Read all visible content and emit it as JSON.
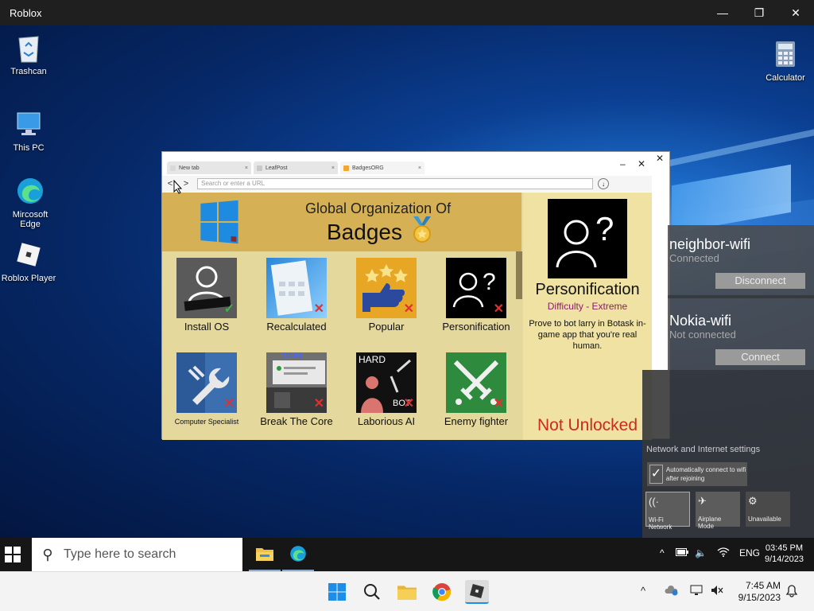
{
  "window": {
    "title": "Roblox",
    "minimize": "—",
    "maximize": "❐",
    "close": "✕"
  },
  "desktop_icons": [
    {
      "label": "Trashcan",
      "icon": "recycle-bin-icon"
    },
    {
      "label": "This PC",
      "icon": "computer-icon"
    },
    {
      "label": "Mircosoft Edge",
      "icon": "edge-icon"
    },
    {
      "label": "Roblox Player",
      "icon": "roblox-icon"
    },
    {
      "label": "Calculator",
      "icon": "calculator-icon"
    }
  ],
  "browser": {
    "tabs": [
      {
        "label": "New tab",
        "close": "×",
        "color": "#d9d9d9"
      },
      {
        "label": "LeafPost",
        "close": "×",
        "color": "#c9c9c9"
      },
      {
        "label": "BadgesORG",
        "close": "×",
        "color": "#f0a830"
      }
    ],
    "minimize": "–",
    "close": "✕",
    "back": "<",
    "forward": ">",
    "url_placeholder": "Search or enter a URL",
    "download": "↓",
    "header_sub": "Global Organization Of",
    "header_title": "Badges",
    "badges": [
      {
        "label": "Install OS",
        "status": "unlocked",
        "mark": "✓"
      },
      {
        "label": "Recalculated",
        "status": "locked",
        "mark": "✕"
      },
      {
        "label": "Popular",
        "status": "locked",
        "mark": "✕"
      },
      {
        "label": "Personification",
        "status": "locked",
        "mark": "✕"
      },
      {
        "label": "Computer Specialist",
        "status": "locked",
        "mark": "✕"
      },
      {
        "label": "Break The Core",
        "status": "locked",
        "mark": "✕",
        "thumb_text": "[MAIN]"
      },
      {
        "label": "Laborious AI",
        "status": "locked",
        "mark": "✕",
        "thumb_text": "HARD",
        "thumb_text2": "BOT"
      },
      {
        "label": "Enemy fighter",
        "status": "locked",
        "mark": "✕"
      }
    ],
    "detail": {
      "name": "Personification",
      "difficulty": "Difficulty - Extreme",
      "description": "Prove to bot larry in Botask in-game app that you're real human.",
      "status": "Not Unlocked",
      "thumb_mark": "?"
    },
    "close_outer": "✕"
  },
  "wifi_panel": {
    "networks": [
      {
        "name": "neighbor-wifi",
        "state": "Connected",
        "action": "Disconnect"
      },
      {
        "name": "Nokia-wifi",
        "state": "Not connected",
        "action": "Connect"
      }
    ],
    "settings_label": "Network and Internet settings",
    "auto_connect": "Automatically connect to wifi after rejoining",
    "auto_check": "✓",
    "tiles": [
      {
        "label": "Wi-Fi Network",
        "icon": "wifi-icon",
        "glyph": "((·"
      },
      {
        "label": "Airplane Mode",
        "icon": "airplane-icon",
        "glyph": "✈"
      },
      {
        "label": "Unavailable",
        "icon": "gear-icon",
        "glyph": "⚙"
      }
    ]
  },
  "inner_taskbar": {
    "search_placeholder": "Type here to search",
    "tray_chevron": "^",
    "lang": "ENG",
    "time": "03:45 PM",
    "date": "9/14/2023"
  },
  "host_taskbar": {
    "tray_chevron": "^",
    "time": "7:45 AM",
    "date": "9/15/2023"
  }
}
